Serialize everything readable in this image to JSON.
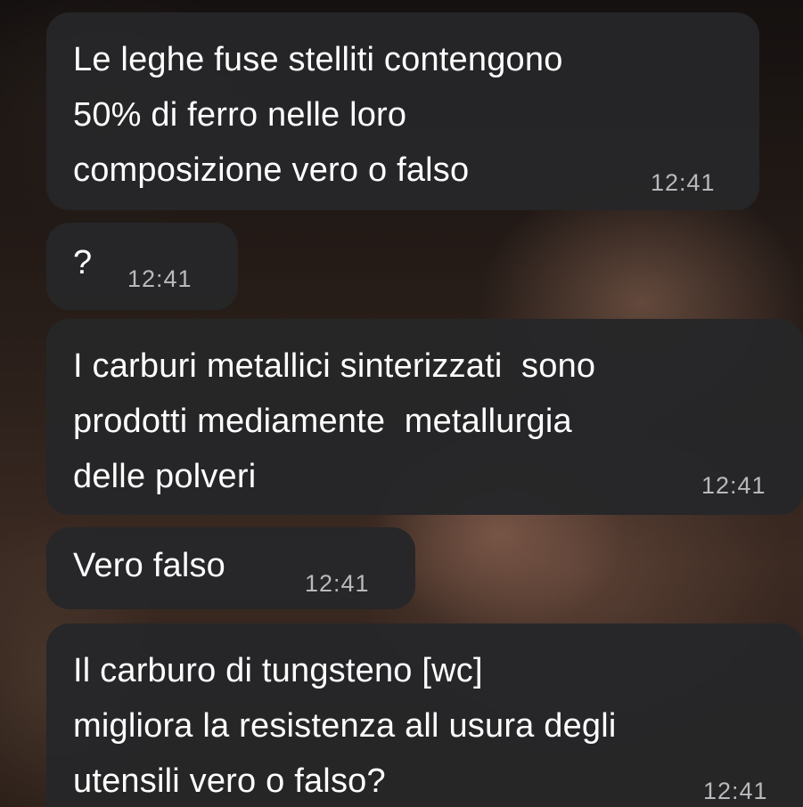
{
  "messages": [
    {
      "text_lines": [
        "Le leghe fuse stelliti contengono",
        "50% di ferro nelle loro",
        "composizione vero o falso"
      ],
      "time": "12:41"
    },
    {
      "text_lines": [
        "?"
      ],
      "time": "12:41"
    },
    {
      "text_lines": [
        "I carburi metallici sinterizzati  sono",
        "prodotti mediamente  metallurgia",
        "delle polveri"
      ],
      "time": "12:41"
    },
    {
      "text_lines": [
        "Vero falso"
      ],
      "time": "12:41"
    },
    {
      "text_lines": [
        "Il carburo di tungsteno [wc]",
        "migliora la resistenza all usura degli",
        "utensili vero o falso?"
      ],
      "time": "12:41"
    }
  ]
}
